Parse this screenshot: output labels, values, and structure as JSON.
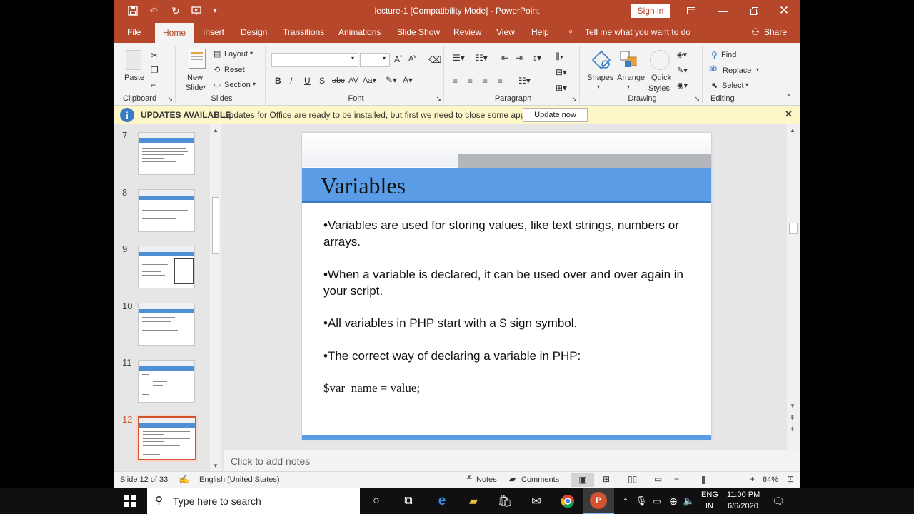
{
  "window": {
    "doc_title": "lecture-1 [Compatibility Mode]  -  PowerPoint",
    "sign_in": "Sign in"
  },
  "tabs": [
    "File",
    "Home",
    "Insert",
    "Design",
    "Transitions",
    "Animations",
    "Slide Show",
    "Review",
    "View",
    "Help"
  ],
  "tell_me": "Tell me what you want to do",
  "share": "Share",
  "ribbon": {
    "paste": "Paste",
    "clipboard": "Clipboard",
    "new_slide_1": "New",
    "new_slide_2": "Slide",
    "layout": "Layout",
    "reset": "Reset",
    "section": "Section",
    "slides": "Slides",
    "font": "Font",
    "paragraph": "Paragraph",
    "shapes": "Shapes",
    "arrange": "Arrange",
    "quick_styles_1": "Quick",
    "quick_styles_2": "Styles",
    "drawing": "Drawing",
    "find": "Find",
    "replace": "Replace",
    "select": "Select",
    "editing": "Editing"
  },
  "update_bar": {
    "title": "UPDATES AVAILABLE",
    "message": "Updates for Office are ready to be installed, but first we need to close some apps.",
    "button": "Update now"
  },
  "thumbnails": [
    {
      "num": "7",
      "title": "PHP Installation",
      "selected": false
    },
    {
      "num": "8",
      "title": "PHP Syntax",
      "selected": false
    },
    {
      "num": "9",
      "title": "Basic Code Syntax",
      "selected": false
    },
    {
      "num": "10",
      "title": "Comments in PHP",
      "selected": false
    },
    {
      "num": "11",
      "title": "Comments in PHP",
      "selected": false
    },
    {
      "num": "12",
      "title": "Variables",
      "selected": true
    }
  ],
  "slide": {
    "title": "Variables",
    "bullets": [
      "•Variables are used for storing values, like text strings, numbers or arrays.",
      "•When a variable is declared, it can be used over and over again in your script.",
      "•All variables in PHP start with a $ sign symbol.",
      "•The correct way of declaring a variable in PHP:"
    ],
    "code": "$var_name = value;"
  },
  "notes_placeholder": "Click to add notes",
  "status": {
    "slide_of": "Slide 12 of 33",
    "language": "English (United States)",
    "notes": "Notes",
    "comments": "Comments",
    "zoom": "64%",
    "zoom_level": 0.64
  },
  "taskbar": {
    "search_placeholder": "Type here to search",
    "lang_1": "ENG",
    "lang_2": "IN",
    "time": "11:00 PM",
    "date": "6/6/2020"
  },
  "colors": {
    "ppt_accent": "#b7472a",
    "slide_title_band": "#5a9de6",
    "update_bar": "#fcf6c8"
  }
}
